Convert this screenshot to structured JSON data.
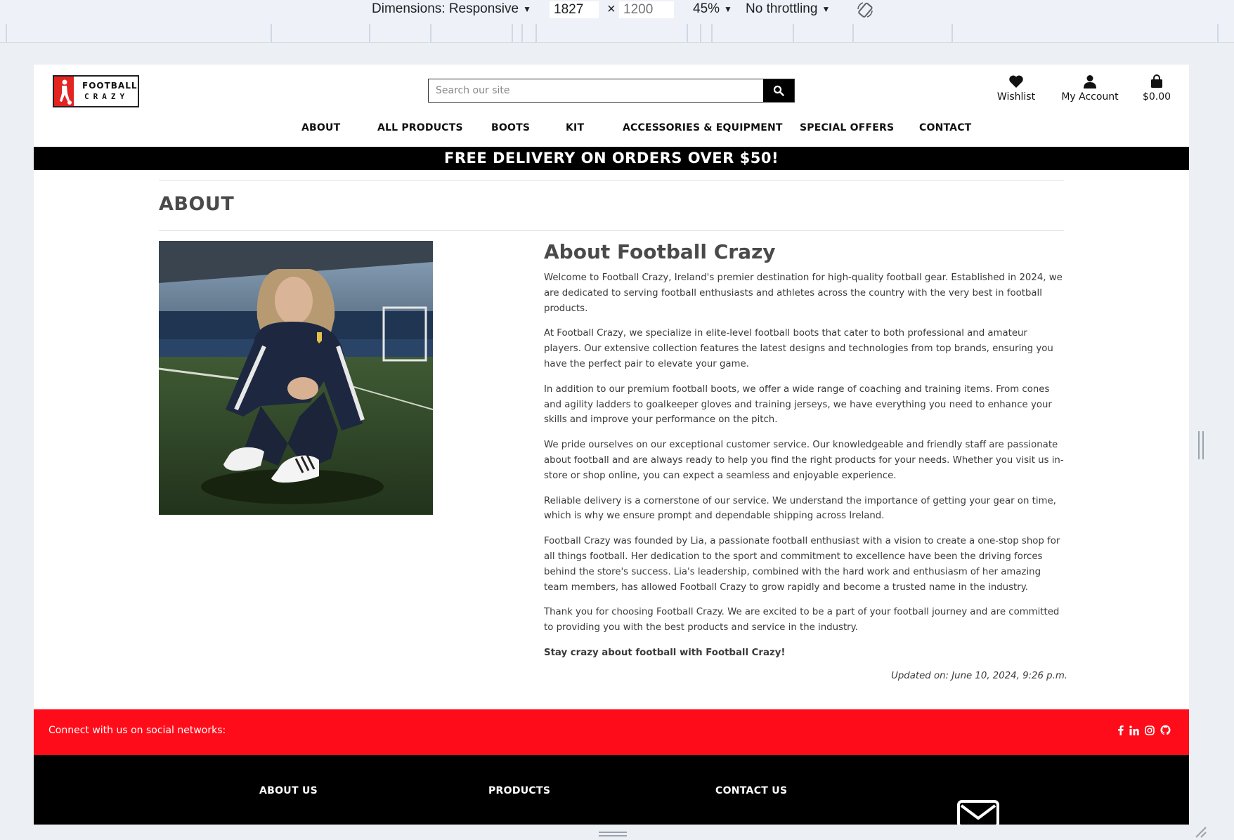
{
  "devtools": {
    "dimensions_label": "Dimensions: Responsive",
    "width_value": "1827",
    "times": "×",
    "height_placeholder": "1200",
    "zoom": "45%",
    "throttling": "No throttling",
    "rotate_icon": "rotate-icon"
  },
  "header": {
    "logo_line1": "FOOTBALL",
    "logo_line2": "CRAZY",
    "search_placeholder": "Search our site",
    "wishlist_label": "Wishlist",
    "account_label": "My Account",
    "bag_total": "$0.00"
  },
  "nav": {
    "items": [
      "ABOUT",
      "ALL PRODUCTS",
      "BOOTS",
      "KIT",
      "ACCESSORIES & EQUIPMENT",
      "SPECIAL OFFERS",
      "CONTACT"
    ]
  },
  "banner": "FREE DELIVERY ON ORDERS OVER $50!",
  "page": {
    "title": "ABOUT",
    "heading": "About Football Crazy",
    "paragraphs": [
      "Welcome to Football Crazy, Ireland's premier destination for high-quality football gear. Established in 2024, we are dedicated to serving football enthusiasts and athletes across the country with the very best in football products.",
      "At Football Crazy, we specialize in elite-level football boots that cater to both professional and amateur players. Our extensive collection features the latest designs and technologies from top brands, ensuring you have the perfect pair to elevate your game.",
      "In addition to our premium football boots, we offer a wide range of coaching and training items. From cones and agility ladders to goalkeeper gloves and training jerseys, we have everything you need to enhance your skills and improve your performance on the pitch.",
      "We pride ourselves on our exceptional customer service. Our knowledgeable and friendly staff are passionate about football and are always ready to help you find the right products for your needs. Whether you visit us in-store or shop online, you can expect a seamless and enjoyable experience.",
      "Reliable delivery is a cornerstone of our service. We understand the importance of getting your gear on time, which is why we ensure prompt and dependable shipping across Ireland.",
      "Football Crazy was founded by Lia, a passionate football enthusiast with a vision to create a one-stop shop for all things football. Her dedication to the sport and commitment to excellence have been the driving forces behind the store's success. Lia's leadership, combined with the hard work and enthusiasm of her amazing team members, has allowed Football Crazy to grow rapidly and become a trusted name in the industry.",
      "Thank you for choosing Football Crazy. We are excited to be a part of your football journey and are committed to providing you with the best products and service in the industry."
    ],
    "closing": "Stay crazy about football with Football Crazy!",
    "updated": "Updated on: June 10, 2024, 9:26 p.m."
  },
  "social": {
    "text": "Connect with us on social networks:",
    "icons": [
      "facebook-icon",
      "linkedin-icon",
      "instagram-icon",
      "github-icon"
    ]
  },
  "footer": {
    "about_us": "ABOUT US",
    "products": "PRODUCTS",
    "contact_us": "CONTACT US"
  },
  "colors": {
    "brand_red": "#ff0c1a",
    "logo_red": "#e32421",
    "banner_black": "#000000",
    "heading_gray": "#4a4a4a"
  }
}
